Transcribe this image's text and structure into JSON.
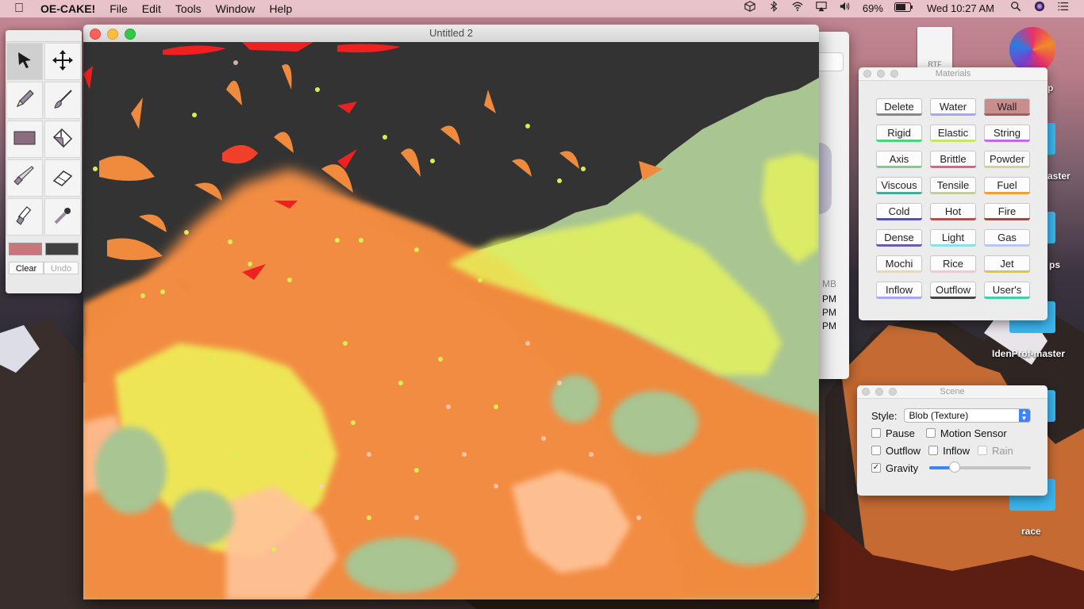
{
  "menubar": {
    "app_name": "OE-CAKE!",
    "menus": [
      "File",
      "Edit",
      "Tools",
      "Window",
      "Help"
    ],
    "battery": "69%",
    "clock": "Wed 10:27 AM"
  },
  "desktop": {
    "labels": [
      "aster",
      "ps",
      "IdenProf-master",
      "race",
      "p"
    ],
    "finder_window": {
      "size_text": "MB",
      "times": [
        "PM",
        "PM",
        "PM"
      ]
    },
    "doc_icon_label": "RTF"
  },
  "tools": {
    "items": [
      {
        "icon": "arrow-pointer-icon"
      },
      {
        "icon": "move-arrows-icon"
      },
      {
        "icon": "pencil-icon"
      },
      {
        "icon": "brush-icon"
      },
      {
        "icon": "rectangle-icon"
      },
      {
        "icon": "paint-bucket-icon"
      },
      {
        "icon": "knife-icon"
      },
      {
        "icon": "eraser-icon"
      },
      {
        "icon": "flashlight-icon"
      },
      {
        "icon": "dropper-icon"
      }
    ],
    "primary_color": "#c8767c",
    "secondary_color": "#404040",
    "clear_label": "Clear",
    "undo_label": "Undo"
  },
  "main_window": {
    "title": "Untitled 2"
  },
  "materials": {
    "title": "Materials",
    "buttons": [
      {
        "label": "Delete",
        "color": "#888888"
      },
      {
        "label": "Water",
        "color": "#a9a6f0"
      },
      {
        "label": "Wall",
        "color": "#a05f5f"
      },
      {
        "label": "Rigid",
        "color": "#4bd47a"
      },
      {
        "label": "Elastic",
        "color": "#c6e66b"
      },
      {
        "label": "String",
        "color": "#c06be8"
      },
      {
        "label": "Axis",
        "color": "#85cc88"
      },
      {
        "label": "Brittle",
        "color": "#e85b8a"
      },
      {
        "label": "Powder",
        "color": "#d6cf9a"
      },
      {
        "label": "Viscous",
        "color": "#4aa7a2"
      },
      {
        "label": "Tensile",
        "color": "#c6cba0"
      },
      {
        "label": "Fuel",
        "color": "#f0a030"
      },
      {
        "label": "Cold",
        "color": "#5548e0"
      },
      {
        "label": "Hot",
        "color": "#e83838"
      },
      {
        "label": "Fire",
        "color": "#b83c3c"
      },
      {
        "label": "Dense",
        "color": "#6d5aa8"
      },
      {
        "label": "Light",
        "color": "#8ce0e8"
      },
      {
        "label": "Gas",
        "color": "#b8c8e8"
      },
      {
        "label": "Mochi",
        "color": "#e8d8b8"
      },
      {
        "label": "Rice",
        "color": "#f0c8d8"
      },
      {
        "label": "Jet",
        "color": "#f0c030"
      },
      {
        "label": "Inflow",
        "color": "#a8a8f0"
      },
      {
        "label": "Outflow",
        "color": "#444444"
      },
      {
        "label": "User's",
        "color": "#3fd0b0"
      }
    ]
  },
  "scene": {
    "title": "Scene",
    "style_label": "Style:",
    "style_value": "Blob (Texture)",
    "pause_label": "Pause",
    "pause_checked": false,
    "motion_label": "Motion Sensor",
    "motion_checked": false,
    "outflow_label": "Outflow",
    "outflow_checked": false,
    "inflow_label": "Inflow",
    "inflow_checked": false,
    "rain_label": "Rain",
    "rain_checked": false,
    "gravity_label": "Gravity",
    "gravity_checked": true,
    "gravity_level": 0.22
  }
}
